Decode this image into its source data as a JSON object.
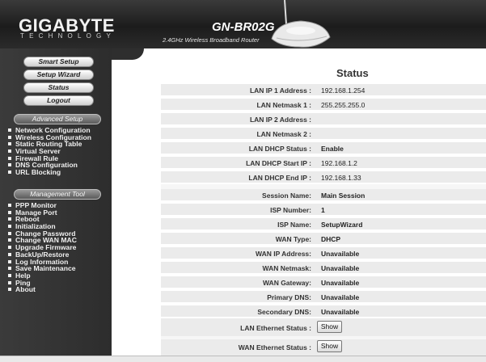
{
  "header": {
    "brand": "GIGABYTE",
    "brand_sub": "TECHNOLOGY",
    "model": "GN-BR02G",
    "model_sub": "2.4GHz Wireless Broadband Router"
  },
  "sidebar": {
    "buttons": [
      "Smart Setup",
      "Setup Wizard",
      "Status",
      "Logout"
    ],
    "advanced_title": "Advanced Setup",
    "advanced_items": [
      "Network Configuration",
      "Wireless Configuration",
      "Static Routing Table",
      "Virtual Server",
      "Firewall Rule",
      "DNS Configuration",
      "URL Blocking"
    ],
    "management_title": "Management Tool",
    "management_items": [
      "PPP Monitor",
      "Manage Port",
      "Reboot",
      "Initialization",
      "Change Password",
      "Change WAN MAC",
      "Upgrade Firmware",
      "BackUp/Restore",
      "Log Information",
      "Save Maintenance",
      "Help",
      "Ping",
      "About"
    ]
  },
  "main": {
    "title": "Status",
    "lan_rows": [
      {
        "label": "LAN IP 1 Address :",
        "value": "192.168.1.254"
      },
      {
        "label": "LAN Netmask 1 :",
        "value": "255.255.255.0"
      },
      {
        "label": "LAN IP 2 Address :",
        "value": ""
      },
      {
        "label": "LAN Netmask 2 :",
        "value": ""
      },
      {
        "label": "LAN DHCP Status :",
        "value": "Enable"
      },
      {
        "label": "LAN DHCP Start IP :",
        "value": "192.168.1.2"
      },
      {
        "label": "LAN DHCP End IP :",
        "value": "192.168.1.33"
      }
    ],
    "wan_rows": [
      {
        "label": "Session Name:",
        "value": "Main Session"
      },
      {
        "label": "ISP Number:",
        "value": "1"
      },
      {
        "label": "ISP Name:",
        "value": "SetupWizard"
      },
      {
        "label": "WAN Type:",
        "value": "DHCP"
      },
      {
        "label": "WAN IP Address:",
        "value": "Unavailable"
      },
      {
        "label": "WAN Netmask:",
        "value": "Unavailable"
      },
      {
        "label": "WAN Gateway:",
        "value": "Unavailable"
      },
      {
        "label": "Primary DNS:",
        "value": "Unavailable"
      },
      {
        "label": "Secondary DNS:",
        "value": "Unavailable"
      }
    ],
    "lan_ethernet_label": "LAN Ethernet Status :",
    "wan_ethernet_label": "WAN Ethernet Status :",
    "show_label": "Show"
  }
}
